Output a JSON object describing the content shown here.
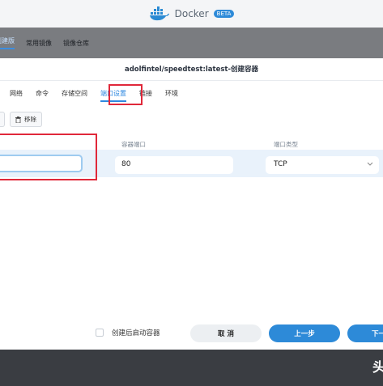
{
  "app": {
    "name": "Docker",
    "badge": "BETA"
  },
  "background_nav": {
    "items": [
      "创建版",
      "常用镜像",
      "镜像仓库"
    ]
  },
  "dialog": {
    "title": "adolfintel/speedtest:latest-创建容器",
    "tabs": [
      "网络",
      "命令",
      "存储空间",
      "端口设置",
      "链接",
      "环境"
    ],
    "active_tab": "端口设置",
    "toolbar": {
      "remove_label": "移除"
    },
    "columns": {
      "host_port": "容器端口",
      "protocol": "端口类型"
    },
    "row": {
      "container_port": "",
      "host_port": "80",
      "protocol": "TCP"
    },
    "footer": {
      "autostart_label": "创建后启动容器",
      "autostart_checked": false,
      "cancel": "取 消",
      "prev": "上一步",
      "next": "下一"
    }
  },
  "colors": {
    "accent": "#2d8ad8",
    "highlight": "#e0283a"
  },
  "watermark": "头"
}
